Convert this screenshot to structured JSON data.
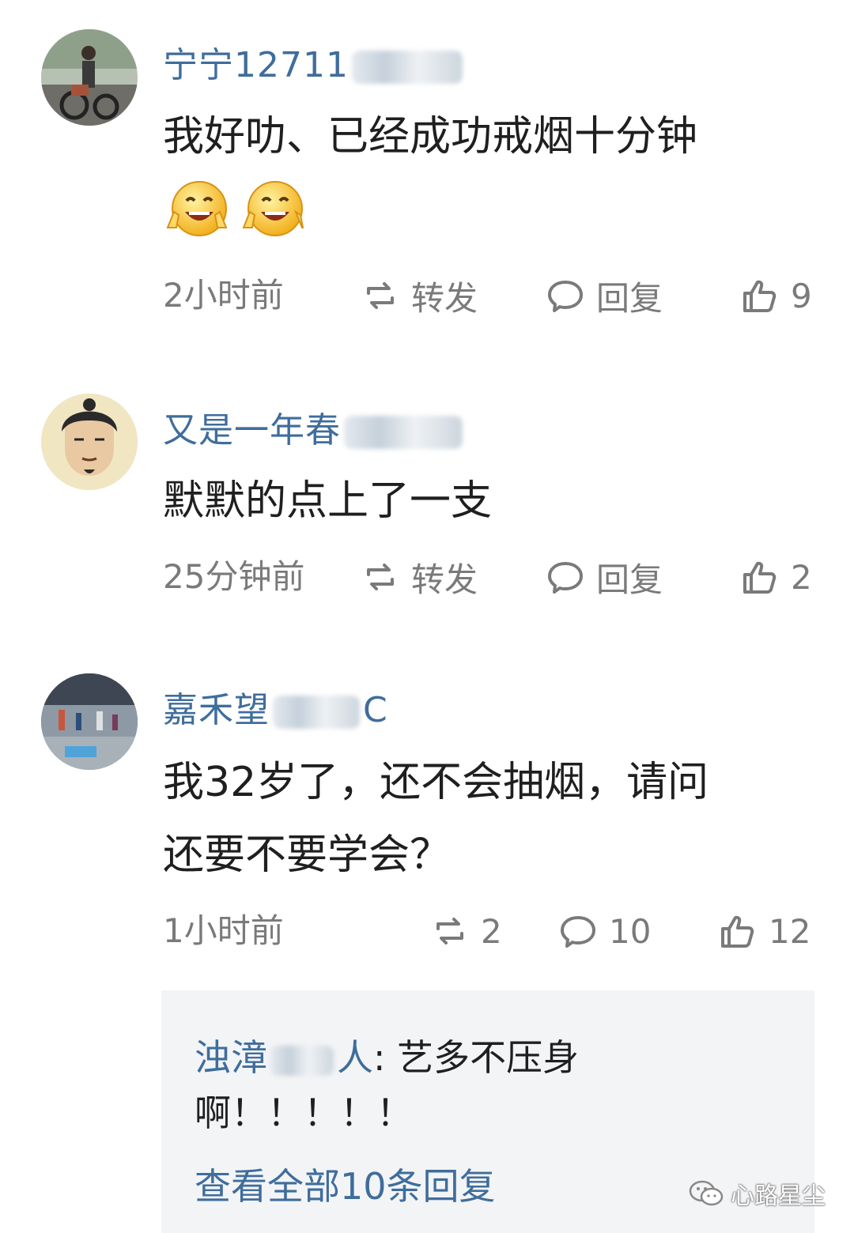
{
  "comments": [
    {
      "username": "宁宁12711",
      "content_line1": "我好叻、已经成功戒烟十分钟",
      "time": "2小时前",
      "repost_label": "转发",
      "reply_label": "回复",
      "likes": "9"
    },
    {
      "username": "又是一年春",
      "content_line1": "默默的点上了一支",
      "time": "25分钟前",
      "repost_label": "转发",
      "reply_label": "回复",
      "likes": "2"
    },
    {
      "username": "嘉禾望",
      "username_suffix": "C",
      "content_line1": "我32岁了，还不会抽烟，请问",
      "content_line2": "还要不要学会？",
      "time": "1小时前",
      "reposts": "2",
      "replies": "10",
      "likes": "12"
    }
  ],
  "reply_preview": {
    "user": "浊漳",
    "user_suffix": "人",
    "text_line1": ": 艺多不压身",
    "text_line2": "啊！！！！！",
    "view_all": "查看全部10条回复"
  },
  "watermark": "心路星尘",
  "colors": {
    "username": "#3f6d9c",
    "meta": "#7a7a7a",
    "reply_bg": "#f3f4f6"
  }
}
